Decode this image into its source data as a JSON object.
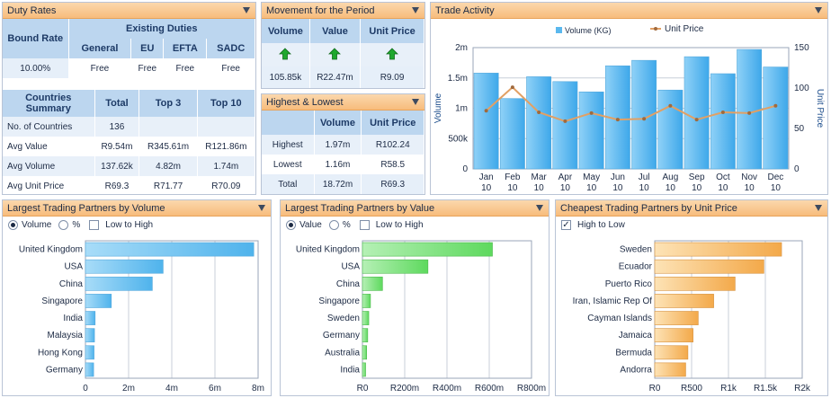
{
  "duty": {
    "title": "Duty Rates",
    "bound_rate_label": "Bound Rate",
    "existing_label": "Existing Duties",
    "cols": [
      "General",
      "EU",
      "EFTA",
      "SADC"
    ],
    "bound_value": "10.00%",
    "values": [
      "Free",
      "Free",
      "Free",
      "Free"
    ]
  },
  "summary": {
    "header": "Countries Summary",
    "cols": [
      "Total",
      "Top 3",
      "Top 10"
    ],
    "rows": [
      {
        "label": "No. of Countries",
        "vals": [
          "136",
          "",
          ""
        ]
      },
      {
        "label": "Avg Value",
        "vals": [
          "R9.54m",
          "R345.61m",
          "R121.86m"
        ]
      },
      {
        "label": "Avg Volume",
        "vals": [
          "137.62k",
          "4.82m",
          "1.74m"
        ]
      },
      {
        "label": "Avg Unit Price",
        "vals": [
          "R69.3",
          "R71.77",
          "R70.09"
        ]
      }
    ]
  },
  "movement": {
    "title": "Movement for the Period",
    "cols": [
      "Volume",
      "Value",
      "Unit Price"
    ],
    "values": [
      "105.85k",
      "R22.47m",
      "R9.09"
    ]
  },
  "highlow": {
    "title": "Highest & Lowest",
    "cols": [
      "Volume",
      "Unit Price"
    ],
    "rows": [
      {
        "label": "Highest",
        "vals": [
          "1.97m",
          "R102.24"
        ]
      },
      {
        "label": "Lowest",
        "vals": [
          "1.16m",
          "R58.5"
        ]
      },
      {
        "label": "Total",
        "vals": [
          "18.72m",
          "R69.3"
        ]
      }
    ]
  },
  "trade": {
    "title": "Trade Activity",
    "legend_volume": "Volume (KG)",
    "legend_price": "Unit Price",
    "ylabel_left": "Volume",
    "ylabel_right": "Unit Price",
    "month_year": "10"
  },
  "partners_volume": {
    "title": "Largest Trading Partners by Volume",
    "opt1": "Volume",
    "opt2": "%",
    "opt3": "Low to High"
  },
  "partners_value": {
    "title": "Largest Trading Partners by Value",
    "opt1": "Value",
    "opt2": "%",
    "opt3": "Low to High"
  },
  "partners_price": {
    "title": "Cheapest Trading Partners by Unit Price",
    "opt1": "High to Low"
  },
  "colors": {
    "volume_bar": "#5ab8ee",
    "value_bar": "#7be07b",
    "price_bar": "#f6b95c",
    "price_line": "#e2a064"
  },
  "chart_data": [
    {
      "type": "bar",
      "name": "Trade Activity",
      "categories": [
        "Jan",
        "Feb",
        "Mar",
        "Apr",
        "May",
        "Jun",
        "Jul",
        "Aug",
        "Sep",
        "Oct",
        "Nov",
        "Dec"
      ],
      "series": [
        {
          "name": "Volume (KG)",
          "type": "bar",
          "axis": "left",
          "values": [
            1580000,
            1160000,
            1520000,
            1440000,
            1270000,
            1700000,
            1790000,
            1300000,
            1850000,
            1570000,
            1970000,
            1680000
          ]
        },
        {
          "name": "Unit Price",
          "type": "line",
          "axis": "right",
          "values": [
            72,
            101,
            70,
            59,
            69,
            61,
            62,
            78,
            61,
            70,
            69,
            78
          ]
        }
      ],
      "yticks_left": [
        "0",
        "500k",
        "1m",
        "1.5m",
        "2m"
      ],
      "ylim_left": [
        0,
        2000000
      ],
      "yticks_right": [
        "0",
        "50",
        "100",
        "150"
      ],
      "ylim_right": [
        0,
        150
      ],
      "ylabel": "Volume",
      "y2label": "Unit Price"
    },
    {
      "type": "bar",
      "name": "Largest Trading Partners by Volume",
      "categories": [
        "United Kingdom",
        "USA",
        "China",
        "Singapore",
        "India",
        "Malaysia",
        "Hong Kong",
        "Germany"
      ],
      "values": [
        7800000,
        3600000,
        3100000,
        1200000,
        450000,
        420000,
        400000,
        380000
      ],
      "xticks": [
        "0",
        "2m",
        "4m",
        "6m",
        "8m"
      ],
      "xlim": [
        0,
        8000000
      ]
    },
    {
      "type": "bar",
      "name": "Largest Trading Partners by Value",
      "categories": [
        "United Kingdom",
        "USA",
        "China",
        "Singapore",
        "Sweden",
        "Germany",
        "Australia",
        "India"
      ],
      "values": [
        615000000,
        310000000,
        95000000,
        38000000,
        30000000,
        25000000,
        20000000,
        15000000
      ],
      "xticks": [
        "R0",
        "R200m",
        "R400m",
        "R600m",
        "R800m"
      ],
      "xlim": [
        0,
        800000000
      ]
    },
    {
      "type": "bar",
      "name": "Cheapest Trading Partners by Unit Price",
      "categories": [
        "Sweden",
        "Ecuador",
        "Puerto Rico",
        "Iran, Islamic Rep Of",
        "Cayman Islands",
        "Jamaica",
        "Bermuda",
        "Andorra"
      ],
      "values": [
        1720,
        1480,
        1090,
        800,
        590,
        520,
        450,
        420
      ],
      "xticks": [
        "R0",
        "R500",
        "R1k",
        "R1.5k",
        "R2k"
      ],
      "xlim": [
        0,
        2000
      ]
    }
  ]
}
